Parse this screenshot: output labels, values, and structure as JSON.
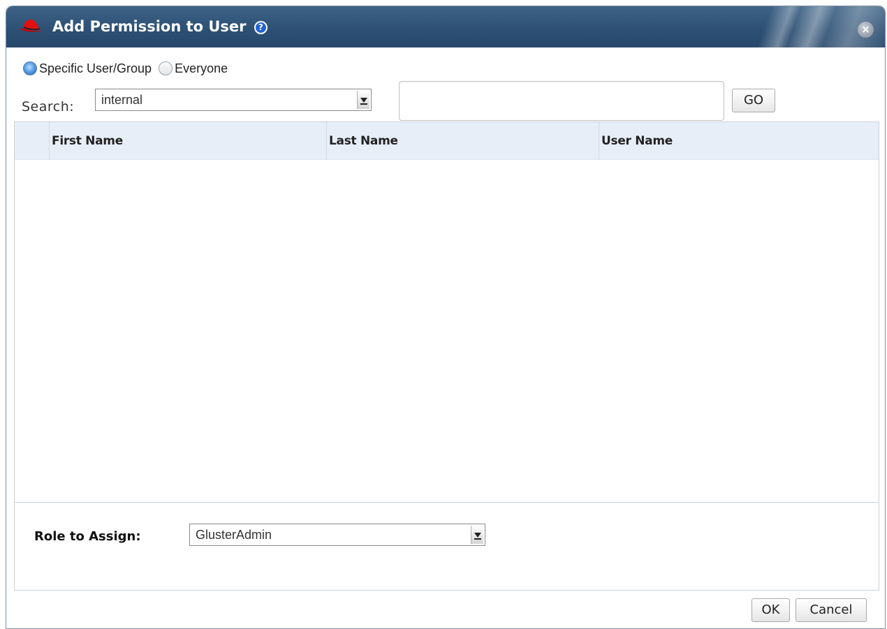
{
  "dialog": {
    "title": "Add Permission to User",
    "help_icon": "?",
    "close_icon": "×"
  },
  "radios": {
    "specific_label": "Specific User/Group",
    "everyone_label": "Everyone",
    "selected": "Specific User/Group"
  },
  "search": {
    "label": "Search:",
    "domain_value": "internal",
    "query_value": "",
    "go_label": "GO"
  },
  "table": {
    "columns": [
      "First Name",
      "Last Name",
      "User Name"
    ],
    "rows": []
  },
  "role": {
    "label": "Role to Assign:",
    "value": "GlusterAdmin"
  },
  "footer": {
    "ok_label": "OK",
    "cancel_label": "Cancel"
  },
  "colors": {
    "titlebar": "#2c4f73",
    "header_row": "#e8eef8",
    "hat": "#cc0000"
  },
  "icons": {
    "logo": "redhat-hat-icon",
    "help": "help-circle-icon",
    "close": "close-circle-icon",
    "dropdown": "dropdown-arrow-icon"
  }
}
